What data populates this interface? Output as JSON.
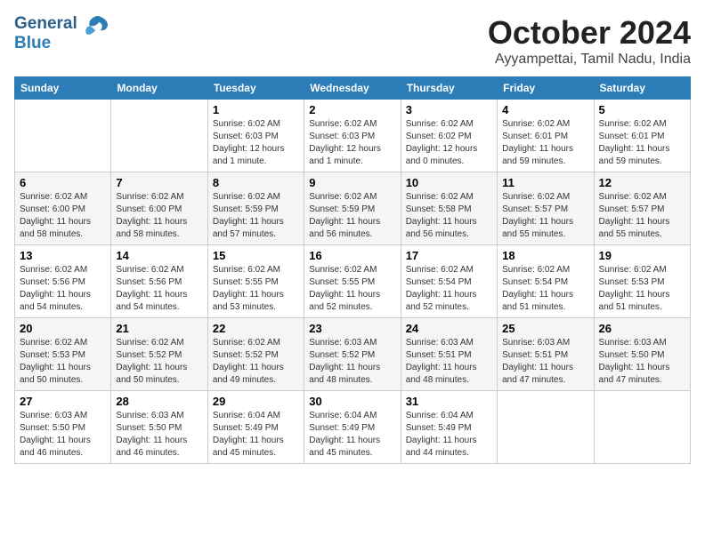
{
  "header": {
    "logo_line1": "General",
    "logo_line2": "Blue",
    "month": "October 2024",
    "location": "Ayyampettai, Tamil Nadu, India"
  },
  "days_of_week": [
    "Sunday",
    "Monday",
    "Tuesday",
    "Wednesday",
    "Thursday",
    "Friday",
    "Saturday"
  ],
  "weeks": [
    [
      {
        "day": "",
        "info": ""
      },
      {
        "day": "",
        "info": ""
      },
      {
        "day": "1",
        "info": "Sunrise: 6:02 AM\nSunset: 6:03 PM\nDaylight: 12 hours and 1 minute."
      },
      {
        "day": "2",
        "info": "Sunrise: 6:02 AM\nSunset: 6:03 PM\nDaylight: 12 hours and 1 minute."
      },
      {
        "day": "3",
        "info": "Sunrise: 6:02 AM\nSunset: 6:02 PM\nDaylight: 12 hours and 0 minutes."
      },
      {
        "day": "4",
        "info": "Sunrise: 6:02 AM\nSunset: 6:01 PM\nDaylight: 11 hours and 59 minutes."
      },
      {
        "day": "5",
        "info": "Sunrise: 6:02 AM\nSunset: 6:01 PM\nDaylight: 11 hours and 59 minutes."
      }
    ],
    [
      {
        "day": "6",
        "info": "Sunrise: 6:02 AM\nSunset: 6:00 PM\nDaylight: 11 hours and 58 minutes."
      },
      {
        "day": "7",
        "info": "Sunrise: 6:02 AM\nSunset: 6:00 PM\nDaylight: 11 hours and 58 minutes."
      },
      {
        "day": "8",
        "info": "Sunrise: 6:02 AM\nSunset: 5:59 PM\nDaylight: 11 hours and 57 minutes."
      },
      {
        "day": "9",
        "info": "Sunrise: 6:02 AM\nSunset: 5:59 PM\nDaylight: 11 hours and 56 minutes."
      },
      {
        "day": "10",
        "info": "Sunrise: 6:02 AM\nSunset: 5:58 PM\nDaylight: 11 hours and 56 minutes."
      },
      {
        "day": "11",
        "info": "Sunrise: 6:02 AM\nSunset: 5:57 PM\nDaylight: 11 hours and 55 minutes."
      },
      {
        "day": "12",
        "info": "Sunrise: 6:02 AM\nSunset: 5:57 PM\nDaylight: 11 hours and 55 minutes."
      }
    ],
    [
      {
        "day": "13",
        "info": "Sunrise: 6:02 AM\nSunset: 5:56 PM\nDaylight: 11 hours and 54 minutes."
      },
      {
        "day": "14",
        "info": "Sunrise: 6:02 AM\nSunset: 5:56 PM\nDaylight: 11 hours and 54 minutes."
      },
      {
        "day": "15",
        "info": "Sunrise: 6:02 AM\nSunset: 5:55 PM\nDaylight: 11 hours and 53 minutes."
      },
      {
        "day": "16",
        "info": "Sunrise: 6:02 AM\nSunset: 5:55 PM\nDaylight: 11 hours and 52 minutes."
      },
      {
        "day": "17",
        "info": "Sunrise: 6:02 AM\nSunset: 5:54 PM\nDaylight: 11 hours and 52 minutes."
      },
      {
        "day": "18",
        "info": "Sunrise: 6:02 AM\nSunset: 5:54 PM\nDaylight: 11 hours and 51 minutes."
      },
      {
        "day": "19",
        "info": "Sunrise: 6:02 AM\nSunset: 5:53 PM\nDaylight: 11 hours and 51 minutes."
      }
    ],
    [
      {
        "day": "20",
        "info": "Sunrise: 6:02 AM\nSunset: 5:53 PM\nDaylight: 11 hours and 50 minutes."
      },
      {
        "day": "21",
        "info": "Sunrise: 6:02 AM\nSunset: 5:52 PM\nDaylight: 11 hours and 50 minutes."
      },
      {
        "day": "22",
        "info": "Sunrise: 6:02 AM\nSunset: 5:52 PM\nDaylight: 11 hours and 49 minutes."
      },
      {
        "day": "23",
        "info": "Sunrise: 6:03 AM\nSunset: 5:52 PM\nDaylight: 11 hours and 48 minutes."
      },
      {
        "day": "24",
        "info": "Sunrise: 6:03 AM\nSunset: 5:51 PM\nDaylight: 11 hours and 48 minutes."
      },
      {
        "day": "25",
        "info": "Sunrise: 6:03 AM\nSunset: 5:51 PM\nDaylight: 11 hours and 47 minutes."
      },
      {
        "day": "26",
        "info": "Sunrise: 6:03 AM\nSunset: 5:50 PM\nDaylight: 11 hours and 47 minutes."
      }
    ],
    [
      {
        "day": "27",
        "info": "Sunrise: 6:03 AM\nSunset: 5:50 PM\nDaylight: 11 hours and 46 minutes."
      },
      {
        "day": "28",
        "info": "Sunrise: 6:03 AM\nSunset: 5:50 PM\nDaylight: 11 hours and 46 minutes."
      },
      {
        "day": "29",
        "info": "Sunrise: 6:04 AM\nSunset: 5:49 PM\nDaylight: 11 hours and 45 minutes."
      },
      {
        "day": "30",
        "info": "Sunrise: 6:04 AM\nSunset: 5:49 PM\nDaylight: 11 hours and 45 minutes."
      },
      {
        "day": "31",
        "info": "Sunrise: 6:04 AM\nSunset: 5:49 PM\nDaylight: 11 hours and 44 minutes."
      },
      {
        "day": "",
        "info": ""
      },
      {
        "day": "",
        "info": ""
      }
    ]
  ]
}
